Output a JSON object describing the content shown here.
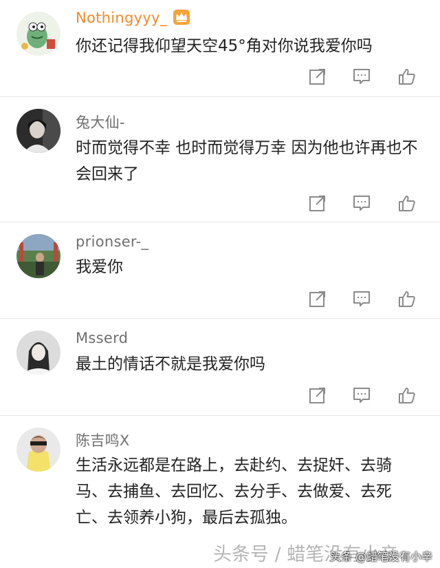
{
  "comments": [
    {
      "username": "Nothingyyy_",
      "text": "你还记得我仰望天空45°角对你说我爱你吗"
    },
    {
      "username": "兔大仙-",
      "text": "时而觉得不幸  也时而觉得万幸 因为他也许再也不会回来了"
    },
    {
      "username": "prionser-_",
      "text": "我爱你"
    },
    {
      "username": "Msserd",
      "text": "最土的情话不就是我爱你吗"
    },
    {
      "username": "陈吉鸣X",
      "text": "生活永远都是在路上，去赴约、去捉奸、去骑马、去捕鱼、去回忆、去分手、去做爱、去死亡、去领养小狗，最后去孤独。"
    }
  ],
  "watermark": {
    "large": "头条号 / 蜡笔没有小辛",
    "small": "头条 @蜡笔没有小辛"
  },
  "colors": {
    "vip_name": "#f28a2a",
    "name": "#6f6f6f",
    "text": "#222222",
    "icon": "#8a8a8a",
    "divider": "#e6e6e6"
  },
  "icons": [
    "share-icon",
    "comment-icon",
    "like-icon",
    "crown-icon"
  ]
}
